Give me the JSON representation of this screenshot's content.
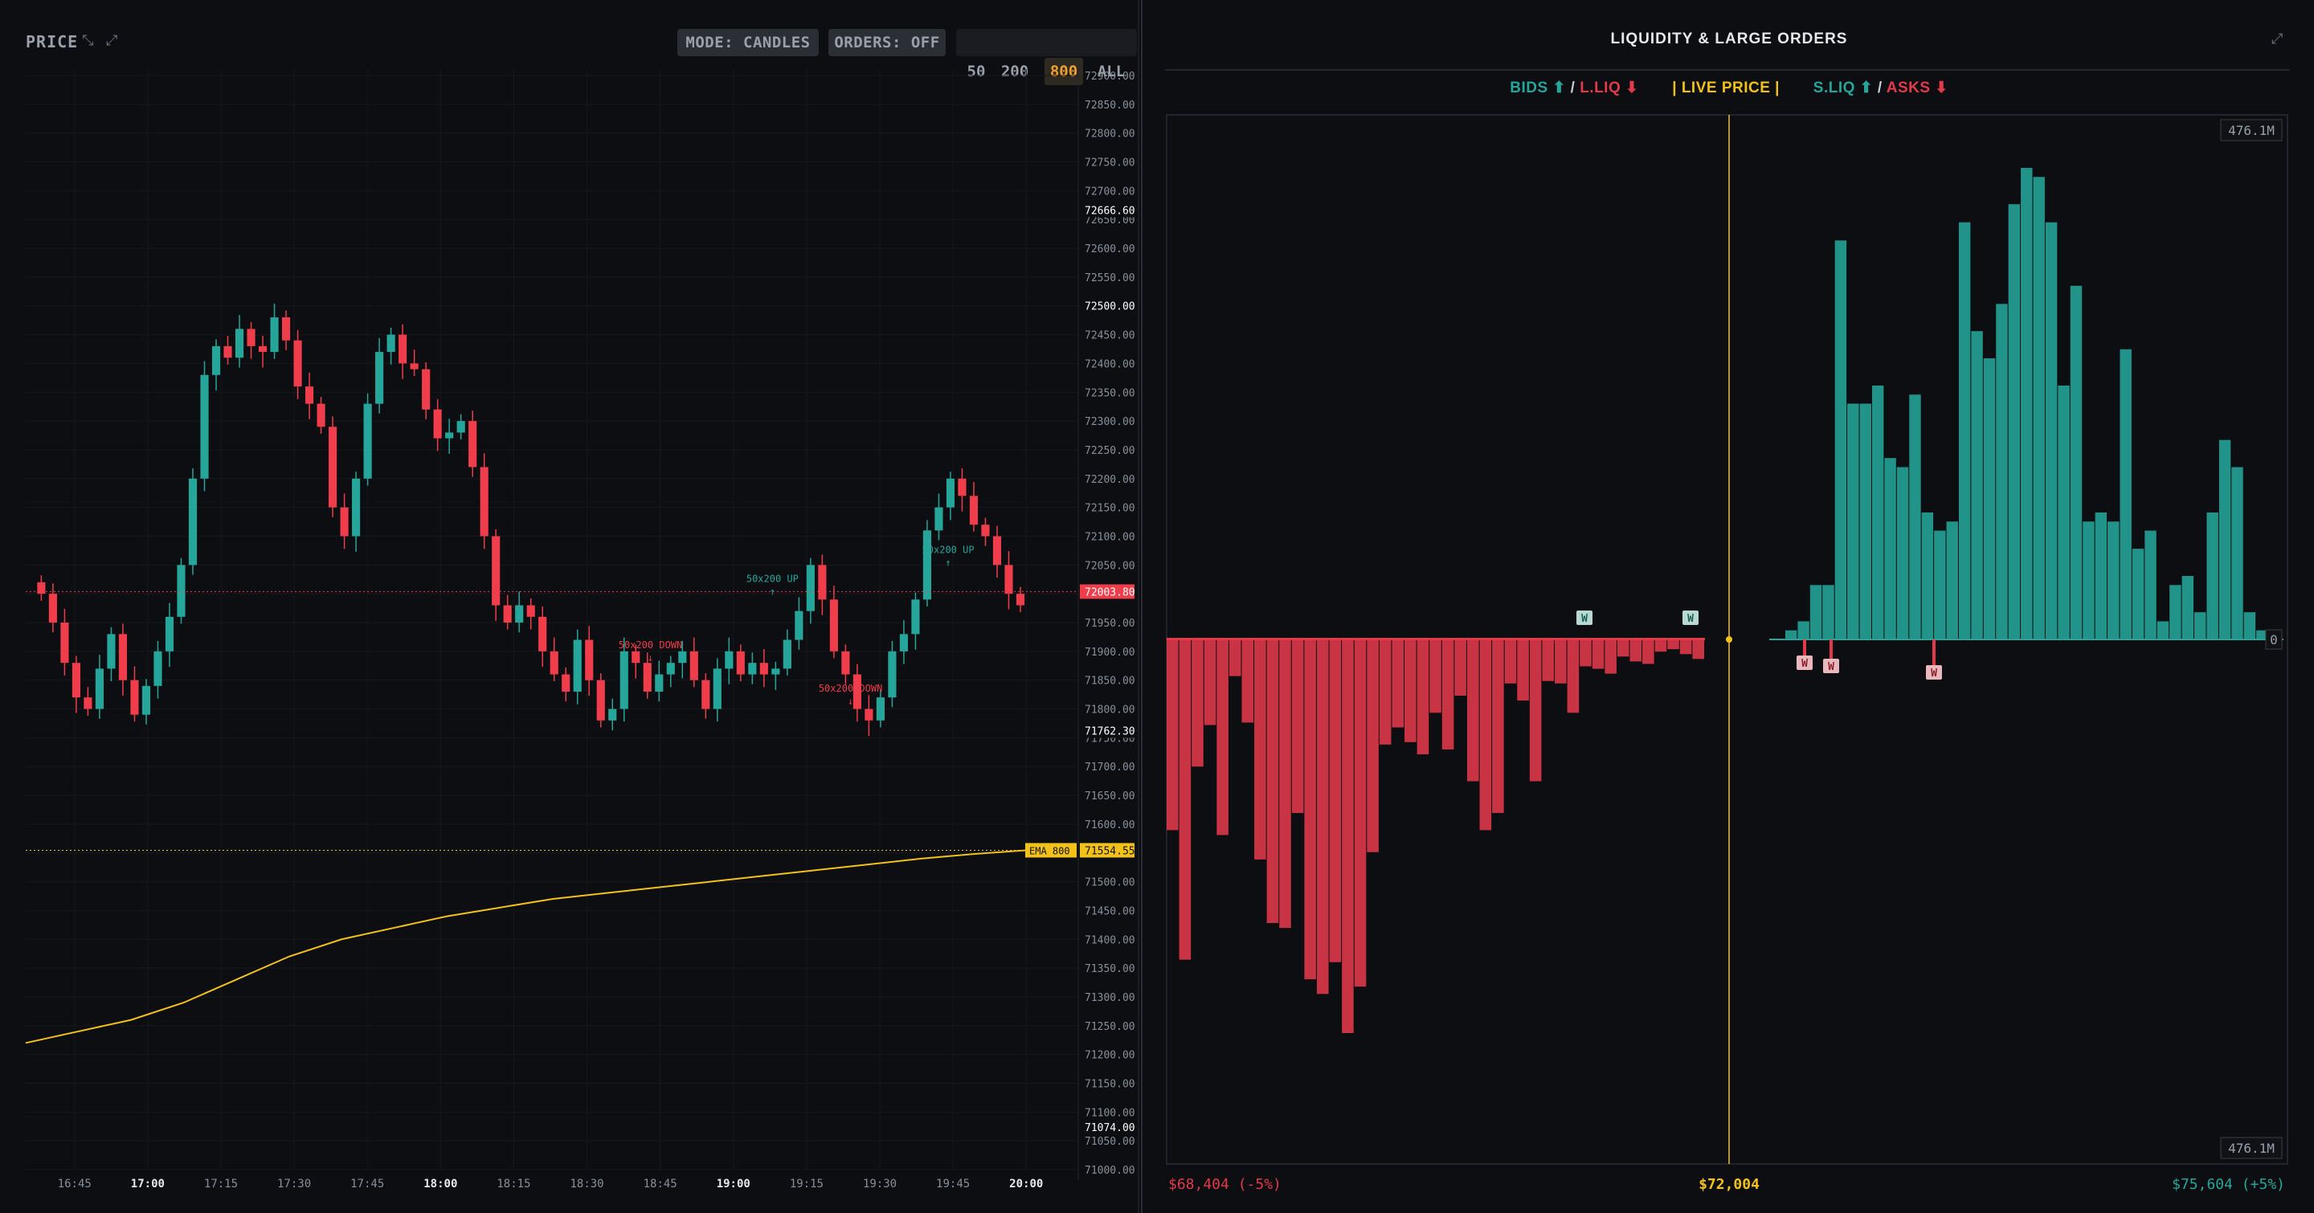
{
  "left": {
    "title": "PRICE",
    "mode_label": "MODE: CANDLES",
    "orders_label": "ORDERS: OFF",
    "range_options": [
      "50",
      "200",
      "800",
      "ALL"
    ],
    "range_selected": "800",
    "y_ticks": [
      "72900.00",
      "72850.00",
      "72800.00",
      "72750.00",
      "72700.00",
      "72650.00",
      "72600.00",
      "72550.00",
      "72500.00",
      "72450.00",
      "72400.00",
      "72350.00",
      "72300.00",
      "72250.00",
      "72200.00",
      "72150.00",
      "72100.00",
      "72050.00",
      "72000.00",
      "71950.00",
      "71900.00",
      "71850.00",
      "71800.00",
      "71750.00",
      "71700.00",
      "71650.00",
      "71600.00",
      "71550.00",
      "71500.00",
      "71450.00",
      "71400.00",
      "71350.00",
      "71300.00",
      "71250.00",
      "71200.00",
      "71150.00",
      "71100.00",
      "71050.00",
      "71000.00"
    ],
    "y_highlights": [
      "72666.60",
      "72500.00",
      "71762.30",
      "71074.00"
    ],
    "x_ticks": [
      "16:45",
      "17:00",
      "17:15",
      "17:30",
      "17:45",
      "18:00",
      "18:15",
      "18:30",
      "18:45",
      "19:00",
      "19:15",
      "19:30",
      "19:45",
      "20:00"
    ],
    "x_ticks_bold": [
      "17:00",
      "18:00",
      "19:00",
      "20:00"
    ],
    "current_price": "72003.80",
    "ema_label": "EMA 800",
    "ema_value": "71554.55",
    "annotations": [
      "50x200 DOWN",
      "50x200 UP",
      "50x200 DOWN",
      "50x200 UP"
    ],
    "colors": {
      "up": "#26a69a",
      "down": "#ef3d4b",
      "ema": "#f2c21b",
      "bg": "#0d0e11"
    }
  },
  "chart_data": [
    {
      "type": "candlestick",
      "title": "PRICE",
      "ylim": [
        71000,
        72900
      ],
      "x_range": [
        "16:35",
        "20:10"
      ],
      "current_price": 72003.8,
      "close_series": [
        72000,
        71950,
        71880,
        71820,
        71800,
        71870,
        71930,
        71850,
        71790,
        71840,
        71900,
        71960,
        72050,
        72200,
        72380,
        72430,
        72410,
        72460,
        72430,
        72420,
        72480,
        72440,
        72360,
        72330,
        72290,
        72150,
        72100,
        72200,
        72330,
        72420,
        72450,
        72400,
        72390,
        72320,
        72270,
        72280,
        72300,
        72220,
        72100,
        71980,
        71950,
        71980,
        71960,
        71900,
        71860,
        71830,
        71920,
        71850,
        71780,
        71800,
        71900,
        71880,
        71830,
        71860,
        71880,
        71900,
        71850,
        71800,
        71870,
        71900,
        71860,
        71880,
        71860,
        71870,
        71920,
        71970,
        72050,
        71990,
        71900,
        71860,
        71800,
        71780,
        71820,
        71900,
        71930,
        71990,
        72110,
        72150,
        72200,
        72170,
        72120,
        72100,
        72050,
        72000,
        71980
      ],
      "ema_800": [
        71220,
        71240,
        71260,
        71290,
        71330,
        71370,
        71400,
        71420,
        71440,
        71455,
        71470,
        71480,
        71490,
        71500,
        71510,
        71520,
        71530,
        71540,
        71548,
        71554.55
      ],
      "signals": [
        {
          "label": "50x200 DOWN",
          "time": "18:43",
          "price": 71880
        },
        {
          "label": "50x200 UP",
          "time": "19:08",
          "price": 71990
        },
        {
          "label": "50x200 DOWN",
          "time": "19:24",
          "price": 71805
        },
        {
          "label": "50x200 UP",
          "time": "19:44",
          "price": 72040
        }
      ]
    },
    {
      "type": "bar",
      "title": "LIQUIDITY & LARGE ORDERS",
      "x_min_label": "$68,404 (-5%)",
      "x_center_label": "$72,004",
      "x_max_label": "$75,604 (+5%)",
      "ylim_label": "476.1M",
      "zero_label": "0",
      "bids": [
        78,
        131,
        52,
        35,
        80,
        15,
        34,
        90,
        116,
        118,
        71,
        139,
        145,
        132,
        161,
        142,
        87,
        43,
        36,
        42,
        47,
        30,
        45,
        23,
        58,
        78,
        71,
        18,
        25,
        58,
        17,
        18,
        30,
        11,
        12,
        14,
        7,
        9,
        10,
        5,
        4,
        6,
        8
      ],
      "asks": [
        1,
        2,
        6,
        6,
        44,
        26,
        26,
        28,
        20,
        19,
        27,
        14,
        12,
        13,
        46,
        34,
        31,
        37,
        48,
        52,
        51,
        46,
        28,
        39,
        13,
        14,
        13,
        32,
        10,
        12,
        2,
        6,
        7,
        3,
        14,
        22,
        19,
        3,
        1,
        0
      ],
      "whale_markers_above": 2,
      "whale_markers_below": 3
    }
  ],
  "right": {
    "title": "LIQUIDITY & LARGE ORDERS",
    "legend_bids": "BIDS ⬆",
    "legend_sep1": " / ",
    "legend_lliq": "L.LIQ ⬇",
    "legend_live": "| LIVE PRICE |",
    "legend_sliq": "S.LIQ ⬆",
    "legend_sep2": " / ",
    "legend_asks": "ASKS ⬇",
    "max_label_top": "476.1M",
    "max_label_bottom": "476.1M",
    "zero_label": "0",
    "whale_marker": "W",
    "x_min_label": "$68,404 (-5%)",
    "x_center_label": "$72,004",
    "x_max_label": "$75,604 (+5%)",
    "colors": {
      "bid": "#26a69a",
      "ask": "#e23a4a",
      "live": "#f2c21b"
    }
  }
}
